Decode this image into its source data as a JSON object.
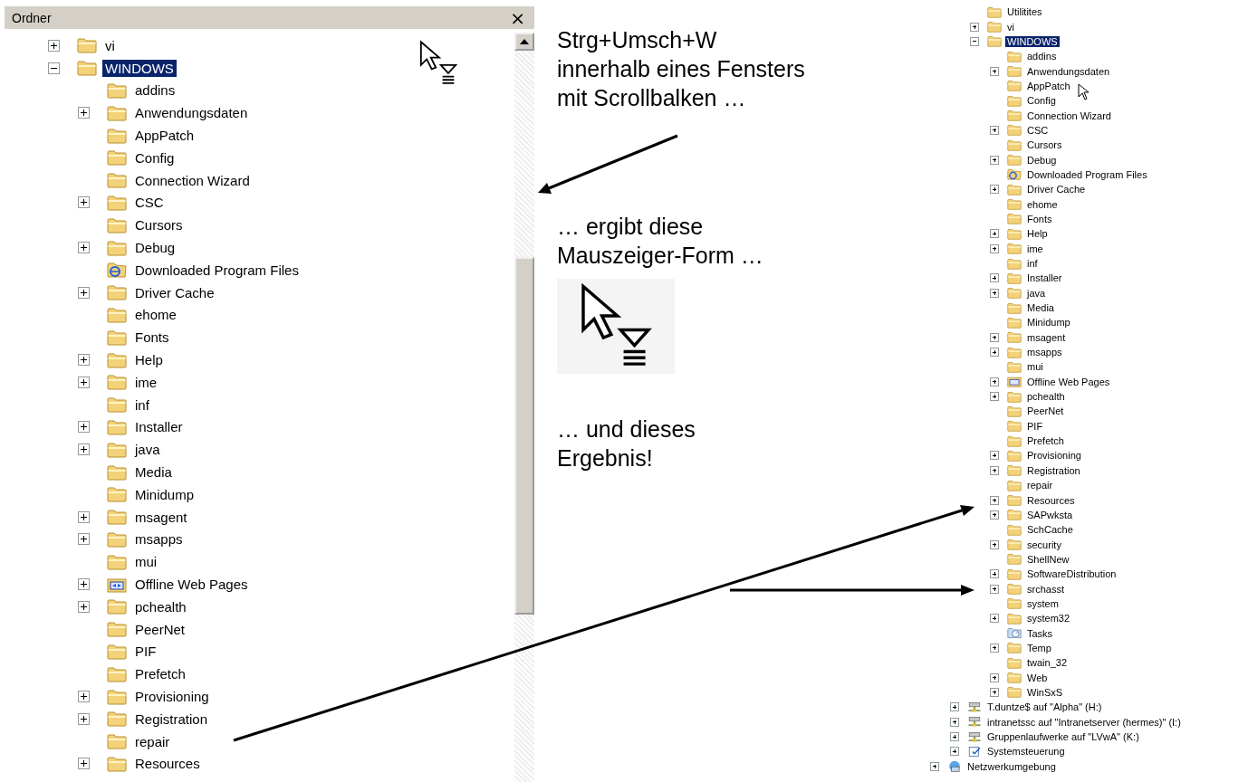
{
  "folder_pane": {
    "title": "Ordner",
    "close": "×",
    "items": [
      {
        "label": "vi",
        "kind": "folder",
        "expanded": false,
        "selected": false
      },
      {
        "label": "WINDOWS",
        "kind": "folder",
        "expanded": true,
        "selected": true,
        "children": [
          {
            "label": "addins",
            "kind": "folder",
            "selected": false
          },
          {
            "label": "Anwendungsdaten",
            "kind": "folder",
            "expanded": false,
            "selected": false
          },
          {
            "label": "AppPatch",
            "kind": "folder",
            "selected": false
          },
          {
            "label": "Config",
            "kind": "folder",
            "selected": false
          },
          {
            "label": "Connection Wizard",
            "kind": "folder",
            "selected": false
          },
          {
            "label": "CSC",
            "kind": "folder",
            "expanded": false,
            "selected": false
          },
          {
            "label": "Cursors",
            "kind": "folder",
            "selected": false
          },
          {
            "label": "Debug",
            "kind": "folder",
            "expanded": false,
            "selected": false
          },
          {
            "label": "Downloaded Program Files",
            "kind": "web-folder",
            "selected": false
          },
          {
            "label": "Driver Cache",
            "kind": "folder",
            "expanded": false,
            "selected": false
          },
          {
            "label": "ehome",
            "kind": "folder",
            "selected": false
          },
          {
            "label": "Fonts",
            "kind": "folder",
            "selected": false
          },
          {
            "label": "Help",
            "kind": "folder",
            "expanded": false,
            "selected": false
          },
          {
            "label": "ime",
            "kind": "folder",
            "expanded": false,
            "selected": false
          },
          {
            "label": "inf",
            "kind": "folder",
            "selected": false
          },
          {
            "label": "Installer",
            "kind": "folder",
            "expanded": false,
            "selected": false
          },
          {
            "label": "java",
            "kind": "folder",
            "expanded": false,
            "selected": false
          },
          {
            "label": "Media",
            "kind": "folder",
            "selected": false
          },
          {
            "label": "Minidump",
            "kind": "folder",
            "selected": false
          },
          {
            "label": "msagent",
            "kind": "folder",
            "expanded": false,
            "selected": false
          },
          {
            "label": "msapps",
            "kind": "folder",
            "expanded": false,
            "selected": false
          },
          {
            "label": "mui",
            "kind": "folder",
            "selected": false
          },
          {
            "label": "Offline Web Pages",
            "kind": "sync-folder",
            "expanded": false,
            "selected": false
          },
          {
            "label": "pchealth",
            "kind": "folder",
            "expanded": false,
            "selected": false
          },
          {
            "label": "PeerNet",
            "kind": "folder",
            "selected": false
          },
          {
            "label": "PIF",
            "kind": "folder",
            "selected": false
          },
          {
            "label": "Prefetch",
            "kind": "folder",
            "selected": false
          },
          {
            "label": "Provisioning",
            "kind": "folder",
            "expanded": false,
            "selected": false
          },
          {
            "label": "Registration",
            "kind": "folder",
            "expanded": false,
            "selected": false
          },
          {
            "label": "repair",
            "kind": "folder",
            "selected": false
          },
          {
            "label": "Resources",
            "kind": "folder",
            "expanded": false,
            "selected": false
          }
        ]
      }
    ]
  },
  "annotations": [
    {
      "text": "Strg+Umsch+W\ninnerhalb eines Fensters\nmit Scrollbalken …"
    },
    {
      "text": "… ergibt diese\nMauszeiger-Form …"
    },
    {
      "text": "… und dieses\nErgebnis!"
    }
  ],
  "result_tree": {
    "items": [
      {
        "children": [
          {
            "children": [
              {
                "label": "Utilitites",
                "kind": "folder",
                "selected": false
              },
              {
                "label": "vi",
                "kind": "folder",
                "expanded": false,
                "selected": false
              },
              {
                "label": "WINDOWS",
                "kind": "folder",
                "expanded": true,
                "selected": true,
                "children": [
                  {
                    "label": "addins",
                    "kind": "folder",
                    "selected": false
                  },
                  {
                    "label": "Anwendungsdaten",
                    "kind": "folder",
                    "expanded": false,
                    "selected": false
                  },
                  {
                    "label": "AppPatch",
                    "kind": "folder",
                    "selected": false
                  },
                  {
                    "label": "Config",
                    "kind": "folder",
                    "selected": false
                  },
                  {
                    "label": "Connection Wizard",
                    "kind": "folder",
                    "selected": false
                  },
                  {
                    "label": "CSC",
                    "kind": "folder",
                    "expanded": false,
                    "selected": false
                  },
                  {
                    "label": "Cursors",
                    "kind": "folder",
                    "selected": false
                  },
                  {
                    "label": "Debug",
                    "kind": "folder",
                    "expanded": false,
                    "selected": false
                  },
                  {
                    "label": "Downloaded Program Files",
                    "kind": "web-folder",
                    "selected": false
                  },
                  {
                    "label": "Driver Cache",
                    "kind": "folder",
                    "expanded": false,
                    "selected": false
                  },
                  {
                    "label": "ehome",
                    "kind": "folder",
                    "selected": false
                  },
                  {
                    "label": "Fonts",
                    "kind": "folder",
                    "selected": false
                  },
                  {
                    "label": "Help",
                    "kind": "folder",
                    "expanded": false,
                    "selected": false
                  },
                  {
                    "label": "ime",
                    "kind": "folder",
                    "expanded": false,
                    "selected": false
                  },
                  {
                    "label": "inf",
                    "kind": "folder",
                    "selected": false
                  },
                  {
                    "label": "Installer",
                    "kind": "folder",
                    "expanded": false,
                    "selected": false
                  },
                  {
                    "label": "java",
                    "kind": "folder",
                    "expanded": false,
                    "selected": false
                  },
                  {
                    "label": "Media",
                    "kind": "folder",
                    "selected": false
                  },
                  {
                    "label": "Minidump",
                    "kind": "folder",
                    "selected": false
                  },
                  {
                    "label": "msagent",
                    "kind": "folder",
                    "expanded": false,
                    "selected": false
                  },
                  {
                    "label": "msapps",
                    "kind": "folder",
                    "expanded": false,
                    "selected": false
                  },
                  {
                    "label": "mui",
                    "kind": "folder",
                    "selected": false
                  },
                  {
                    "label": "Offline Web Pages",
                    "kind": "sync-folder",
                    "expanded": false,
                    "selected": false
                  },
                  {
                    "label": "pchealth",
                    "kind": "folder",
                    "expanded": false,
                    "selected": false
                  },
                  {
                    "label": "PeerNet",
                    "kind": "folder",
                    "selected": false
                  },
                  {
                    "label": "PIF",
                    "kind": "folder",
                    "selected": false
                  },
                  {
                    "label": "Prefetch",
                    "kind": "folder",
                    "selected": false
                  },
                  {
                    "label": "Provisioning",
                    "kind": "folder",
                    "expanded": false,
                    "selected": false
                  },
                  {
                    "label": "Registration",
                    "kind": "folder",
                    "expanded": false,
                    "selected": false
                  },
                  {
                    "label": "repair",
                    "kind": "folder",
                    "selected": false
                  },
                  {
                    "label": "Resources",
                    "kind": "folder",
                    "expanded": false,
                    "selected": false
                  },
                  {
                    "label": "SAPwksta",
                    "kind": "folder",
                    "expanded": false,
                    "selected": false
                  },
                  {
                    "label": "SchCache",
                    "kind": "folder",
                    "selected": false
                  },
                  {
                    "label": "security",
                    "kind": "folder",
                    "expanded": false,
                    "selected": false
                  },
                  {
                    "label": "ShellNew",
                    "kind": "folder",
                    "selected": false
                  },
                  {
                    "label": "SoftwareDistribution",
                    "kind": "folder",
                    "expanded": false,
                    "selected": false
                  },
                  {
                    "label": "srchasst",
                    "kind": "folder",
                    "expanded": false,
                    "selected": false
                  },
                  {
                    "label": "system",
                    "kind": "folder",
                    "selected": false
                  },
                  {
                    "label": "system32",
                    "kind": "folder",
                    "expanded": false,
                    "selected": false
                  },
                  {
                    "label": "Tasks",
                    "kind": "tasks",
                    "selected": false
                  },
                  {
                    "label": "Temp",
                    "kind": "folder",
                    "expanded": false,
                    "selected": false
                  },
                  {
                    "label": "twain_32",
                    "kind": "folder",
                    "selected": false
                  },
                  {
                    "label": "Web",
                    "kind": "folder",
                    "expanded": false,
                    "selected": false
                  },
                  {
                    "label": "WinSxS",
                    "kind": "folder",
                    "expanded": false,
                    "selected": false
                  }
                ]
              }
            ]
          },
          {
            "label": "T.duntze$ auf \"Alpha\" (H:)",
            "kind": "network-drive",
            "expanded": false,
            "selected": false
          },
          {
            "label": "intranetssc auf \"Intranetserver (hermes)\" (I:)",
            "kind": "network-drive",
            "expanded": false,
            "selected": false
          },
          {
            "label": "Gruppenlaufwerke auf \"LVwA\" (K:)",
            "kind": "network-drive",
            "expanded": false,
            "selected": false
          },
          {
            "label": "Systemsteuerung",
            "kind": "control-panel",
            "expanded": false,
            "selected": false
          }
        ]
      },
      {
        "label": "Netzwerkumgebung",
        "kind": "network",
        "expanded": false,
        "selected": false
      }
    ]
  }
}
